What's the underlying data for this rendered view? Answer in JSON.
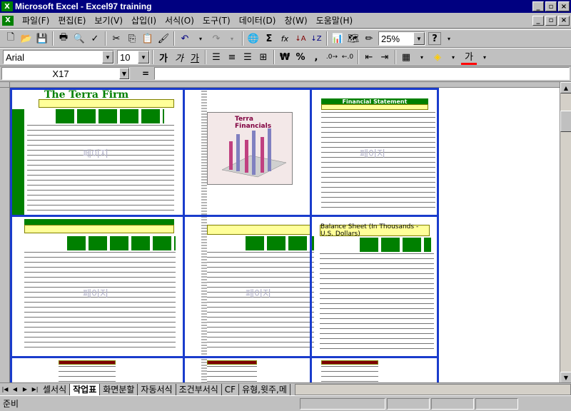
{
  "window": {
    "title": "Microsoft Excel - Excel97 training",
    "app_icon": "excel-icon",
    "btn_min": "_",
    "btn_max": "▫",
    "btn_close": "×"
  },
  "menu": {
    "items": [
      "파일(F)",
      "편집(E)",
      "보기(V)",
      "삽입(I)",
      "서식(O)",
      "도구(T)",
      "데이터(D)",
      "창(W)",
      "도움말(H)"
    ]
  },
  "toolbar": {
    "zoom": "25%",
    "help_label": "?",
    "sum_label": "Σ",
    "fx_label": "fx",
    "sort_asc": "↓A",
    "sort_desc": "↓Z"
  },
  "format": {
    "font": "Arial",
    "size": "10",
    "bold": "가",
    "italic": "가",
    "underline": "가",
    "currency": "₩",
    "percent": "%",
    "comma": ",",
    "font_color_label": "가"
  },
  "formula_bar": {
    "cell_ref": "X17",
    "equals": "="
  },
  "sheet": {
    "page_labels": [
      "페이지",
      "페이지",
      "페이지",
      "페이지"
    ],
    "report_title": "The Terra Firm",
    "chart_title": "Terra Financials",
    "balance_title": "Balance Sheet (In Thousands - U.S. Dollars)",
    "financial_title": "Financial Statement"
  },
  "tabs": {
    "items": [
      "셀서식",
      "작업표",
      "화면분할",
      "자동서식",
      "조건부서식",
      "CF",
      "유형,윗주,메"
    ],
    "active_index": 1
  },
  "status": {
    "text": "준비"
  }
}
